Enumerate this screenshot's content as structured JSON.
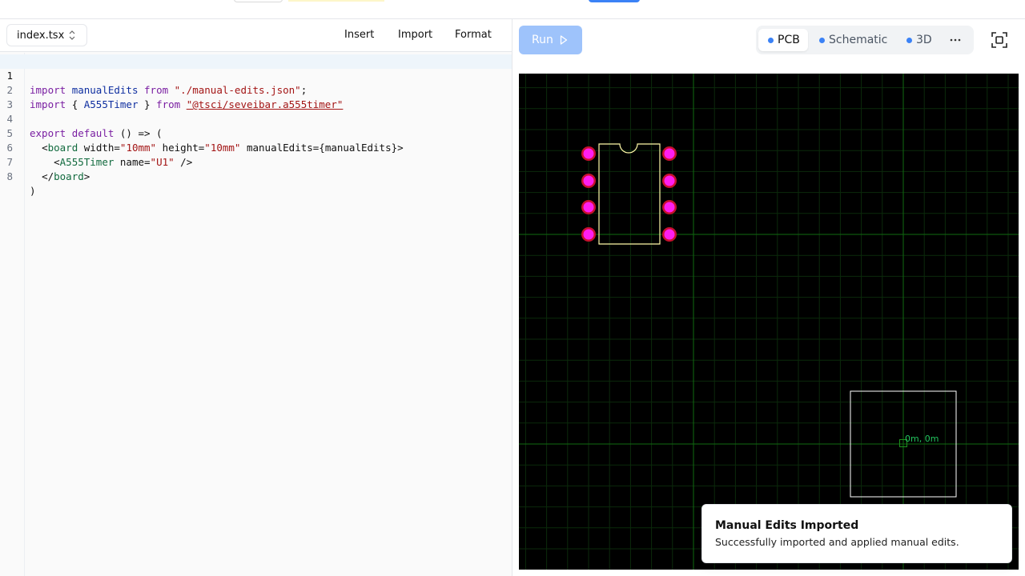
{
  "editor": {
    "file_name": "index.tsx",
    "toolbar": {
      "insert_label": "Insert",
      "import_label": "Import",
      "format_label": "Format"
    },
    "line_numbers": [
      "1",
      "2",
      "3",
      "4",
      "5",
      "6",
      "7",
      "8"
    ],
    "code": {
      "l1": {
        "kw_import": "import",
        "ident": "manualEdits",
        "kw_from": "from",
        "str": "\"./manual-edits.json\"",
        "semi": ";"
      },
      "l2": {
        "kw_import": "import",
        "open": "{ ",
        "ident": "A555Timer",
        "close": " }",
        "kw_from": "from",
        "str": "\"@tsci/seveibar.a555timer\""
      },
      "l4": {
        "kw_export": "export",
        "kw_default": "default",
        "rest": "() => ("
      },
      "l5": {
        "lt": "<",
        "tag": "board",
        "attr1": "width=",
        "val1": "\"10mm\"",
        "attr2": "height=",
        "val2": "\"10mm\"",
        "attr3": "manualEdits={manualEdits}",
        "gt": ">"
      },
      "l6": {
        "lt": "<",
        "tag": "A555Timer",
        "attr": "name=",
        "val": "\"U1\"",
        "end": " />"
      },
      "l7": {
        "lt": "</",
        "tag": "board",
        "gt": ">"
      },
      "l8": {
        "paren": ")"
      }
    }
  },
  "preview": {
    "run_label": "Run",
    "tabs": [
      {
        "label": "PCB",
        "active": true
      },
      {
        "label": "Schematic",
        "active": false
      },
      {
        "label": "3D",
        "active": false
      }
    ],
    "more_icon": "ellipsis-icon",
    "fullscreen_icon": "fullscreen-icon",
    "pcb": {
      "coordinate_label": "0m, 0m",
      "pad_color": "#ff1ef0",
      "pad_ring_color": "#c8102e",
      "silkscreen_color": "#fff9a8",
      "grid_color": "#0b3d0b",
      "axis_color": "#0f6b0f",
      "board_outline_color": "#ffffff"
    }
  },
  "toast": {
    "title": "Manual Edits Imported",
    "description": "Successfully imported and applied manual edits."
  },
  "colors": {
    "accent": "#3b82f6",
    "run_disabled": "#9ec3fb"
  }
}
